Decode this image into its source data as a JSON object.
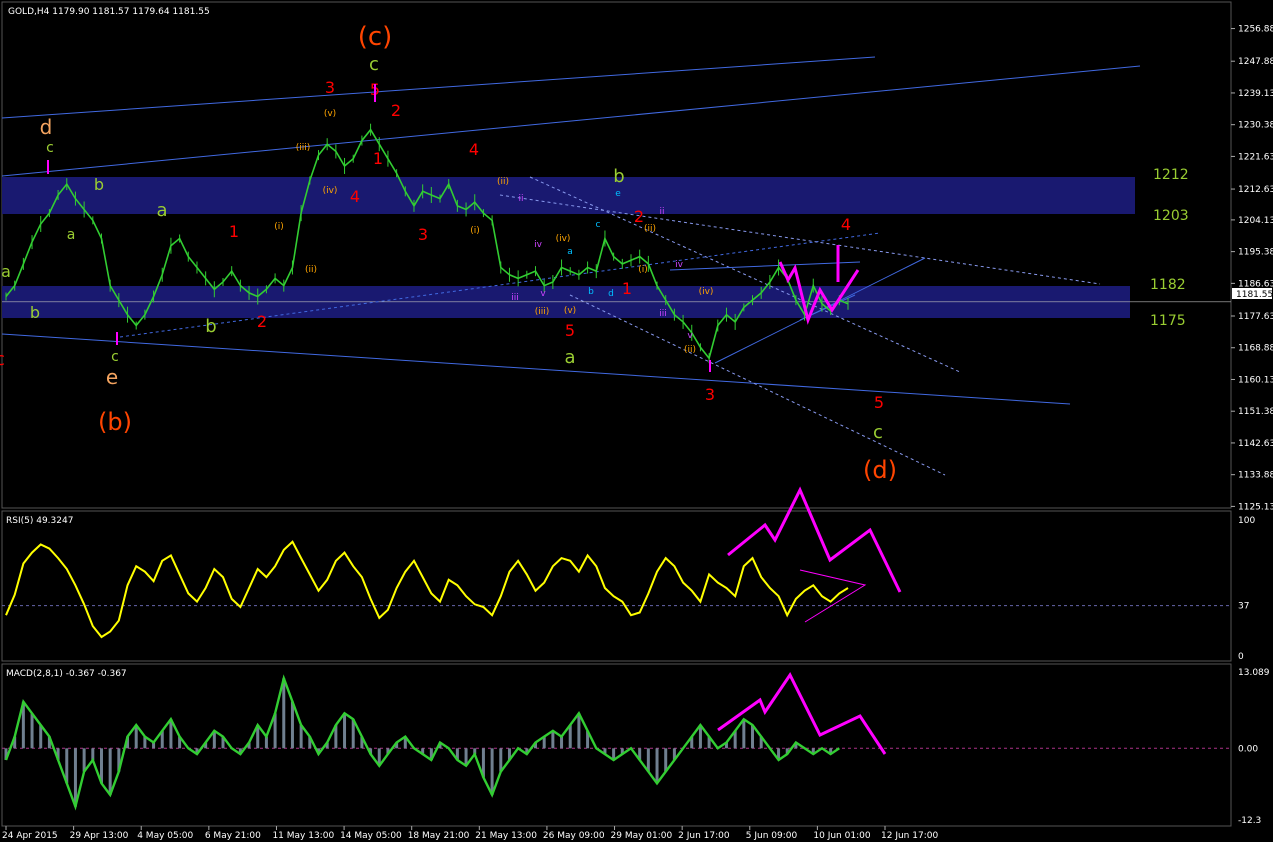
{
  "header": {
    "main": "GOLD,H4  1179.90 1181.57 1179.64 1181.55",
    "rsi": "RSI(5) 49.3247",
    "macd": "MACD(2,8,1) -0.367 -0.367"
  },
  "current_price_label": "1181.55",
  "chart_data": {
    "type": "line",
    "title": "GOLD,H4",
    "price_axis": {
      "ylim": [
        1128.0,
        1262.0
      ],
      "ticks": [
        "1256.88",
        "1247.88",
        "1239.13",
        "1230.38",
        "1221.63",
        "1212.63",
        "1204.13",
        "1195.38",
        "1186.63",
        "1177.63",
        "1168.88",
        "1160.13",
        "1151.38",
        "1142.63",
        "1133.88",
        "1125.13"
      ]
    },
    "x_ticks": [
      "24 Apr 2015",
      "29 Apr 13:00",
      "4 May 05:00",
      "6 May 21:00",
      "11 May 13:00",
      "14 May 05:00",
      "18 May 21:00",
      "21 May 13:00",
      "26 May 09:00",
      "29 May 01:00",
      "2 Jun 17:00",
      "5 Jun 09:00",
      "10 Jun 01:00",
      "12 Jun 17:00"
    ],
    "series": [
      {
        "values": [
          1183,
          1186,
          1192,
          1198,
          1203,
          1206,
          1211,
          1214,
          1210,
          1207,
          1204,
          1199,
          1186,
          1182,
          1178,
          1175,
          1178,
          1183,
          1189,
          1197,
          1199,
          1194,
          1191,
          1188,
          1185,
          1187,
          1190,
          1186,
          1184,
          1183,
          1185,
          1188,
          1186,
          1191,
          1206,
          1215,
          1222,
          1225,
          1223,
          1219,
          1221,
          1226,
          1229,
          1225,
          1221,
          1217,
          1212,
          1208,
          1212,
          1211,
          1210,
          1214,
          1208,
          1207,
          1209,
          1206,
          1204,
          1191,
          1189,
          1188,
          1189,
          1190,
          1186,
          1187,
          1191,
          1190,
          1189,
          1191,
          1190,
          1199,
          1194,
          1192,
          1193,
          1194,
          1192,
          1186,
          1182,
          1178,
          1176,
          1173,
          1169,
          1166,
          1175,
          1178,
          1176,
          1180,
          1182,
          1184,
          1187,
          1191,
          1188,
          1182,
          1178,
          1186,
          1181,
          1179,
          1182,
          1181
        ]
      }
    ],
    "zones": [
      {
        "label": "1212",
        "top": 1212,
        "bottom": 1203
      },
      {
        "label": "1203",
        "top": 1203,
        "bottom": 1203
      },
      {
        "label": "1182",
        "top": 1182,
        "bottom": 1175
      },
      {
        "label": "1175",
        "top": 1175,
        "bottom": 1175
      }
    ],
    "rsi": {
      "ylim": [
        0,
        100
      ],
      "ticks": [
        "100",
        "37",
        "0"
      ],
      "values": [
        30,
        45,
        68,
        76,
        82,
        79,
        72,
        64,
        52,
        38,
        22,
        14,
        18,
        26,
        52,
        66,
        62,
        55,
        70,
        74,
        60,
        46,
        40,
        50,
        64,
        58,
        42,
        36,
        50,
        64,
        58,
        66,
        78,
        84,
        72,
        60,
        48,
        56,
        70,
        76,
        66,
        58,
        42,
        28,
        34,
        50,
        62,
        70,
        58,
        46,
        40,
        56,
        52,
        44,
        38,
        36,
        30,
        44,
        62,
        70,
        60,
        48,
        54,
        66,
        72,
        70,
        62,
        74,
        66,
        50,
        44,
        40,
        30,
        32,
        46,
        62,
        72,
        66,
        54,
        48,
        40,
        60,
        54,
        50,
        44,
        66,
        72,
        58,
        50,
        44,
        30,
        42,
        48,
        52,
        44,
        40,
        46,
        50
      ]
    },
    "macd": {
      "ylim": [
        -12.3,
        13.089
      ],
      "ticks": [
        "13.089",
        "0.00",
        "-12.3"
      ],
      "values": [
        -2,
        2,
        8,
        6,
        4,
        2,
        -2,
        -6,
        -10,
        -4,
        -2,
        -6,
        -8,
        -4,
        2,
        4,
        2,
        1,
        3,
        5,
        2,
        0,
        -1,
        1,
        3,
        2,
        0,
        -1,
        1,
        4,
        2,
        6,
        12,
        8,
        4,
        2,
        -1,
        1,
        4,
        6,
        5,
        2,
        -1,
        -3,
        -1,
        1,
        2,
        0,
        -1,
        -2,
        1,
        0,
        -2,
        -3,
        -1,
        -5,
        -8,
        -4,
        -2,
        0,
        -1,
        1,
        2,
        3,
        2,
        4,
        6,
        3,
        0,
        -1,
        -2,
        -1,
        0,
        -2,
        -4,
        -6,
        -4,
        -2,
        0,
        2,
        4,
        2,
        0,
        1,
        3,
        5,
        4,
        2,
        0,
        -2,
        -1,
        1,
        0,
        -1,
        0,
        -1,
        0
      ]
    }
  },
  "wave_labels": [
    {
      "t": "(c)",
      "c": "#ff4500"
    },
    {
      "t": "c",
      "c": "#9acd32"
    },
    {
      "t": "3",
      "c": "#ff0000"
    },
    {
      "t": "5",
      "c": "#ff0000"
    },
    {
      "t": "2",
      "c": "#ff0000"
    },
    {
      "t": "1",
      "c": "#ff0000"
    },
    {
      "t": "4",
      "c": "#ff0000"
    },
    {
      "t": "4",
      "c": "#ff0000"
    },
    {
      "t": "d",
      "c": "#f4a460"
    },
    {
      "t": "c",
      "c": "#9acd32"
    },
    {
      "t": "b",
      "c": "#9acd32"
    },
    {
      "t": "a",
      "c": "#9acd32"
    },
    {
      "t": "a",
      "c": "#9acd32"
    },
    {
      "t": "b",
      "c": "#9acd32"
    },
    {
      "t": "a",
      "c": "#9acd32"
    },
    {
      "t": "b",
      "c": "#9acd32"
    },
    {
      "t": "1",
      "c": "#ff0000"
    },
    {
      "t": "2",
      "c": "#ff0000"
    },
    {
      "t": "c",
      "c": "#9acd32"
    },
    {
      "t": "e",
      "c": "#f4a460"
    },
    {
      "t": "(b)",
      "c": "#ff4500"
    },
    {
      "t": "3",
      "c": "#ff0000"
    },
    {
      "t": "b",
      "c": "#9acd32"
    },
    {
      "t": "2",
      "c": "#ff0000"
    },
    {
      "t": "1",
      "c": "#ff0000"
    },
    {
      "t": "5",
      "c": "#ff0000"
    },
    {
      "t": "a",
      "c": "#9acd32"
    },
    {
      "t": "3",
      "c": "#ff0000"
    },
    {
      "t": "4",
      "c": "#ff0000"
    },
    {
      "t": "5",
      "c": "#ff0000"
    },
    {
      "t": "c",
      "c": "#9acd32"
    },
    {
      "t": "(d)",
      "c": "#ff4500"
    },
    {
      "t": "(v)",
      "c": "#ffa500"
    },
    {
      "t": "(iii)",
      "c": "#ffa500"
    },
    {
      "t": "(iv)",
      "c": "#ffa500"
    },
    {
      "t": "(i)",
      "c": "#ffa500"
    },
    {
      "t": "(ii)",
      "c": "#ffa500"
    },
    {
      "t": "(ii)",
      "c": "#ffa500"
    },
    {
      "t": "(i)",
      "c": "#ffa500"
    },
    {
      "t": "(iv)",
      "c": "#ffa500"
    },
    {
      "t": "(iii)",
      "c": "#ffa500"
    },
    {
      "t": "(v)",
      "c": "#ffa500"
    },
    {
      "t": "(ii)",
      "c": "#ffa500"
    },
    {
      "t": "(i)",
      "c": "#ffa500"
    },
    {
      "t": "(iv)",
      "c": "#ffa500"
    },
    {
      "t": "(ii)",
      "c": "#ffa500"
    },
    {
      "t": "e",
      "c": "#00bfff"
    },
    {
      "t": "c",
      "c": "#00bfff"
    },
    {
      "t": "a",
      "c": "#00bfff"
    },
    {
      "t": "b",
      "c": "#00bfff"
    },
    {
      "t": "d",
      "c": "#00bfff"
    },
    {
      "t": "ii",
      "c": "#cc44ff"
    },
    {
      "t": "iv",
      "c": "#cc44ff"
    },
    {
      "t": "iii",
      "c": "#cc44ff"
    },
    {
      "t": "v",
      "c": "#cc44ff"
    },
    {
      "t": "ii",
      "c": "#cc44ff"
    },
    {
      "t": "iv",
      "c": "#cc44ff"
    },
    {
      "t": "iii",
      "c": "#cc44ff"
    },
    {
      "t": "v",
      "c": "#cc44ff"
    },
    {
      "t": "c",
      "c": "#ff0000"
    }
  ],
  "colors": {
    "price": "#32cd32",
    "rsi": "#ffff00",
    "macd_line": "#32cd32",
    "macd_hist": "#708090",
    "zone": "#191970",
    "trend": "#4169e1",
    "arrow": "#ff00ff"
  }
}
